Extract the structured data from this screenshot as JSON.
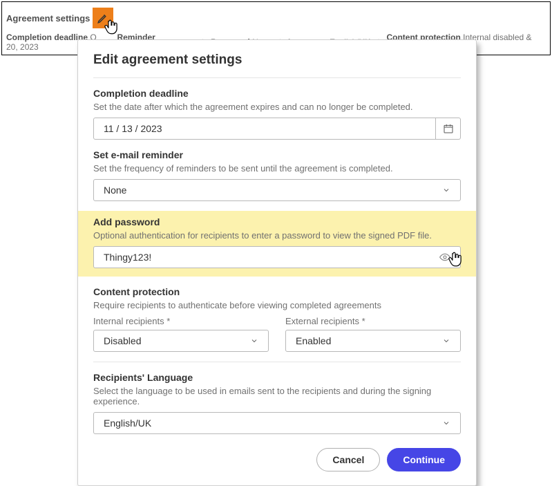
{
  "topbar": {
    "title": "Agreement settings",
    "completion_deadline_label": "Completion deadline",
    "completion_deadline_value": "O      20, 2023",
    "reminder_label": "Reminder frequency",
    "reminder_value": "None",
    "password_label": "Password",
    "password_value": "None",
    "language_label": "Language",
    "language_value": "English/UK",
    "protection_label": "Content protection",
    "protection_value": "Internal disabled & External enabled"
  },
  "modal": {
    "title": "Edit agreement settings",
    "deadline": {
      "title": "Completion deadline",
      "desc": "Set the date after which the agreement expires and can no longer be completed.",
      "value": "11 /  13 /  2023"
    },
    "reminder": {
      "title": "Set e-mail reminder",
      "desc": "Set the frequency of reminders to be sent until the agreement is completed.",
      "value": "None"
    },
    "password": {
      "title": "Add password",
      "desc": "Optional authentication for recipients to enter a password to view the signed PDF file.",
      "value": "Thingy123!"
    },
    "protection": {
      "title": "Content protection",
      "desc": "Require recipients to authenticate before viewing completed agreements",
      "internal_label": "Internal recipients",
      "internal_value": "Disabled",
      "external_label": "External recipients",
      "external_value": "Enabled"
    },
    "language": {
      "title": "Recipients' Language",
      "desc": "Select the language to be used in emails sent to the recipients and during the signing experience.",
      "value": "English/UK"
    },
    "cancel": "Cancel",
    "continue": "Continue"
  }
}
